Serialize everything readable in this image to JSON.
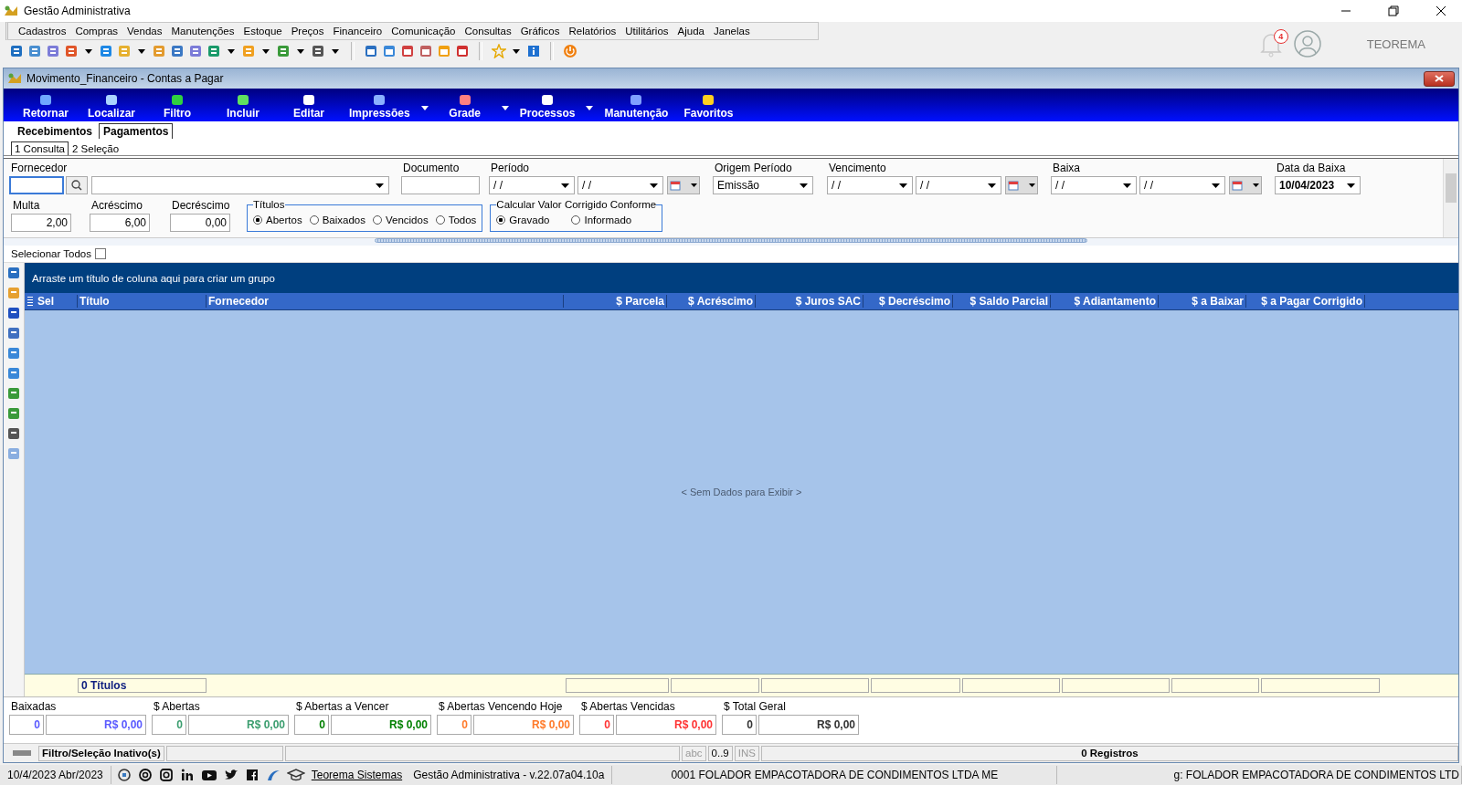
{
  "app": {
    "title": "Gestão Administrativa"
  },
  "menu": [
    "Cadastros",
    "Compras",
    "Vendas",
    "Manutenções",
    "Estoque",
    "Preços",
    "Financeiro",
    "Comunicação",
    "Consultas",
    "Gráficos",
    "Relatórios",
    "Utilitários",
    "Ajuda",
    "Janelas"
  ],
  "notifications": {
    "count": "4"
  },
  "user": {
    "name": "TEOREMA"
  },
  "window": {
    "title": "Movimento_Financeiro - Contas a Pagar"
  },
  "actions": [
    {
      "label": "Retornar",
      "dropdown": false
    },
    {
      "label": "Localizar",
      "dropdown": false
    },
    {
      "label": "Filtro",
      "dropdown": false
    },
    {
      "label": "Incluir",
      "dropdown": false
    },
    {
      "label": "Editar",
      "dropdown": false
    },
    {
      "label": "Impressões",
      "dropdown": true
    },
    {
      "label": "Grade",
      "dropdown": true
    },
    {
      "label": "Processos",
      "dropdown": true
    },
    {
      "label": "Manutenção",
      "dropdown": false
    },
    {
      "label": "Favoritos",
      "dropdown": false
    }
  ],
  "tabs": [
    {
      "label": "Recebimentos",
      "selected": false
    },
    {
      "label": "Pagamentos",
      "selected": true
    }
  ],
  "subtabs": [
    {
      "label": "1 Consulta",
      "selected": true
    },
    {
      "label": "2 Seleção",
      "selected": false
    }
  ],
  "filters": {
    "fornecedor": {
      "label": "Fornecedor"
    },
    "documento": {
      "label": "Documento"
    },
    "periodo": {
      "label": "Período",
      "from": "/ /",
      "to": "/ /"
    },
    "origem": {
      "label": "Origem Período",
      "value": "Emissão"
    },
    "vencimento": {
      "label": "Vencimento",
      "from": "/ /",
      "to": "/ /"
    },
    "baixa": {
      "label": "Baixa",
      "from": "/ /",
      "to": "/ /"
    },
    "data_baixa": {
      "label": "Data da Baixa",
      "value": "10/04/2023"
    },
    "multa": {
      "label": "Multa",
      "value": "2,00"
    },
    "acrescimo": {
      "label": "Acréscimo",
      "value": "6,00"
    },
    "decrescimo": {
      "label": "Decréscimo",
      "value": "0,00"
    },
    "titulos": {
      "title": "Títulos",
      "options": [
        {
          "label": "Abertos",
          "selected": true
        },
        {
          "label": "Baixados",
          "selected": false
        },
        {
          "label": "Vencidos",
          "selected": false
        },
        {
          "label": "Todos",
          "selected": false
        }
      ]
    },
    "calcular": {
      "title": "Calcular Valor Corrigido Conforme",
      "options": [
        {
          "label": "Gravado",
          "selected": true
        },
        {
          "label": "Informado",
          "selected": false
        }
      ]
    }
  },
  "select_all": {
    "label": "Selecionar Todos",
    "checked": false
  },
  "grid": {
    "group_hint": "Arraste um título de coluna aqui para criar um grupo",
    "columns": [
      "Sel",
      "Título",
      "Fornecedor",
      "$ Parcela",
      "$ Acréscimo",
      "$ Juros SAC",
      "$ Decréscimo",
      "$ Saldo Parcial",
      "$ Adiantamento",
      "$ a Baixar",
      "$ a Pagar Corrigido"
    ],
    "empty": "< Sem Dados para Exibir >",
    "footer": "0 Títulos"
  },
  "totals": [
    {
      "label": "Baixadas",
      "count": "0",
      "amount": "R$ 0,00",
      "color": "#5a5aff"
    },
    {
      "label": "$ Abertas",
      "count": "0",
      "amount": "R$ 0,00",
      "color": "#3a9d6e"
    },
    {
      "label": "$ Abertas a Vencer",
      "count": "0",
      "amount": "R$ 0,00",
      "color": "#008000"
    },
    {
      "label": "$ Abertas Vencendo Hoje",
      "count": "0",
      "amount": "R$ 0,00",
      "color": "#ff7a2a"
    },
    {
      "label": "$ Abertas Vencidas",
      "count": "0",
      "amount": "R$ 0,00",
      "color": "#ff3333"
    },
    {
      "label": "$ Total Geral",
      "count": "0",
      "amount": "R$ 0,00",
      "color": "#333333"
    }
  ],
  "status": {
    "filter": "Filtro/Seleção Inativo(s)",
    "abc": "abc",
    "num": "0..9",
    "ins": "INS",
    "records": "0 Registros"
  },
  "footer": {
    "date": "10/4/2023 Abr/2023",
    "link": "Teorema Sistemas",
    "version": "Gestão Administrativa - v.22.07a04.10a",
    "company": "0001 FOLADOR EMPACOTADORA DE CONDIMENTOS LTDA ME",
    "company_right": "g: FOLADOR EMPACOTADORA DE CONDIMENTOS LTD"
  }
}
